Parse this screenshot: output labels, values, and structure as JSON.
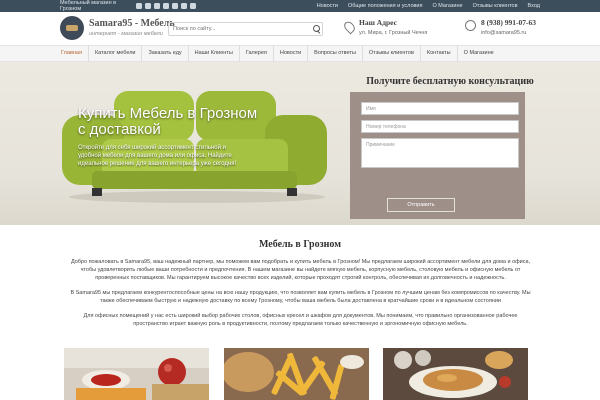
{
  "topbar": {
    "tagline": "Мебельный магазин в Грозном",
    "social_icons": [
      "vk-icon",
      "facebook-icon",
      "youtube-icon",
      "whatsapp-icon",
      "telegram-icon",
      "odnoklassniki-icon",
      "instagram-icon"
    ],
    "links": [
      "Новости",
      "Общие положения и условия",
      "О Магазине",
      "Отзывы клиентов",
      "Вход"
    ]
  },
  "header": {
    "logo_title": "Samara95 - Мебель",
    "logo_subtitle": "интернет - магазин мебели",
    "search_placeholder": "Поиск по сайту...",
    "address_title": "Наш Адрес",
    "address_line": "ул. Мира, г. Грозный Чечня",
    "phone": "8 (938) 991-07-63",
    "email": "info@samara95.ru"
  },
  "nav": {
    "items": [
      "Главная",
      "Каталог мебели",
      "Заказать еду",
      "Наши Клиенты",
      "Галерея",
      "Новости",
      "Вопросы ответы",
      "Отзывы клиентов",
      "Контакты",
      "О Магазине"
    ],
    "active_index": 0
  },
  "hero": {
    "title": "Купить Мебель в Грозном с доставкой",
    "text": "Откройте для себя широкий ассортимент стильной и удобной мебели для вашего дома или офиса. Найдите идеальное решение для вашего интерьера уже сегодня!"
  },
  "form": {
    "title": "Получите бесплатную консультацию",
    "name_placeholder": "Имя",
    "phone_placeholder": "Номер телефона",
    "note_placeholder": "Примечание",
    "submit_label": "Отправить"
  },
  "content": {
    "title": "Мебель в Грозном",
    "p1": "Добро пожаловать в Samara95, ваш надежный партнер, мы поможем вам подобрать и купить мебель в Грозном! Мы предлагаем широкий ассортимент мебели для дома и офиса, чтобы удовлетворить любые ваши потребности и предпочтения. В нашем магазине вы найдете мягкую мебель, корпусную мебель, столовую мебель и офисную мебель от проверенных поставщиков. Мы гарантируем высокое качество всех изделий, которые проходят строгий контроль, обеспечивая их долговечность и надежность.",
    "p2": "В Samara95 мы предлагаем конкурентоспособные цены на всю нашу продукцию, что позволяет вам купить мебель в Грозном по лучшим ценам без компромиссов по качеству. Мы также обеспечиваем быструю и надежную доставку по всему Грозному, чтобы ваша мебель была доставлена в кратчайшие сроки и в идеальном состоянии",
    "p3": "Для офисных помещений у нас есть широкий выбор рабочих столов, офисных кресел и шкафов для документов. Мы понимаем, что правильно организованное рабочее пространство играет важную роль в продуктивности, поэтому предлагаем только качественную и эргономичную офисную мебель."
  },
  "colors": {
    "topbar_bg": "#3c4e5c",
    "accent": "#b2662c",
    "form_bg": "#9e8f89",
    "sofa": "#9fbd3a"
  }
}
